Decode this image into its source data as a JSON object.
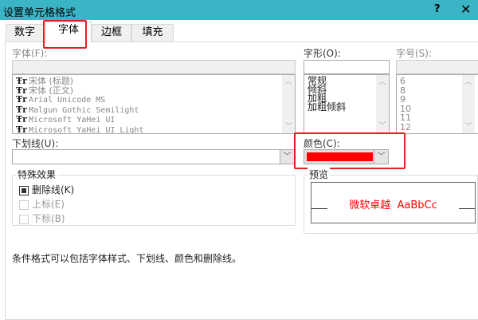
{
  "window": {
    "title": "设置单元格格式",
    "help": "?",
    "close": "✕"
  },
  "tabs": [
    {
      "label": "数字"
    },
    {
      "label": "字体"
    },
    {
      "label": "边框"
    },
    {
      "label": "填充"
    }
  ],
  "font": {
    "label": "字体(F):",
    "value": "",
    "items": [
      "宋体 (标题)",
      "宋体 (正文)",
      "Arial Unicode MS",
      "Malgun Gothic Semilight",
      "Microsoft YaHei UI",
      "Microsoft YaHei UI Light"
    ]
  },
  "style": {
    "label": "字形(O):",
    "value": "",
    "items": [
      "常规",
      "倾斜",
      "加粗",
      "加粗倾斜"
    ]
  },
  "size": {
    "label": "字号(S):",
    "value": "",
    "items": [
      "6",
      "8",
      "9",
      "10",
      "11",
      "12"
    ]
  },
  "underline": {
    "label": "下划线(U):",
    "value": ""
  },
  "color": {
    "label": "颜色(C):",
    "value": "#ff0000"
  },
  "effects": {
    "title": "特殊效果",
    "items": [
      {
        "label": "删除线(K)",
        "checked": true,
        "enabled": true
      },
      {
        "label": "上标(E)",
        "checked": false,
        "enabled": false
      },
      {
        "label": "下标(B)",
        "checked": false,
        "enabled": false
      }
    ]
  },
  "preview": {
    "title": "预览",
    "sample": "微软卓越  AaBbCc",
    "color": "#ff0000"
  },
  "note": "条件格式可以包括字体样式、下划线、颜色和删除线。"
}
